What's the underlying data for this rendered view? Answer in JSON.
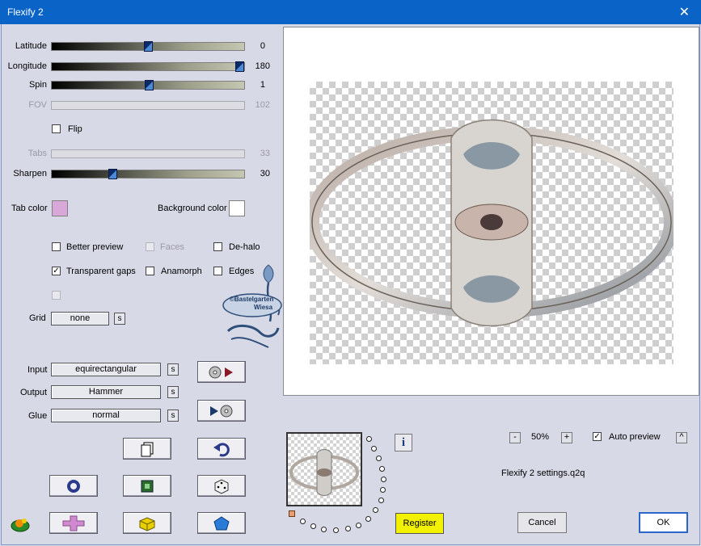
{
  "window": {
    "title": "Flexify 2",
    "close_glyph": "✕"
  },
  "sliders": [
    {
      "label": "Latitude",
      "value": "0",
      "fraction": 0.5,
      "enabled": true
    },
    {
      "label": "Longitude",
      "value": "180",
      "fraction": 1.0,
      "enabled": true
    },
    {
      "label": "Spin",
      "value": "1",
      "fraction": 0.505,
      "enabled": true
    },
    {
      "label": "FOV",
      "value": "102",
      "enabled": false
    },
    {
      "label": "Tabs",
      "value": "33",
      "enabled": false
    },
    {
      "label": "Sharpen",
      "value": "30",
      "fraction": 0.31,
      "enabled": true
    }
  ],
  "flip": {
    "label": "Flip",
    "checked": false
  },
  "tab_color": {
    "label": "Tab color",
    "color": "#d8a8d8"
  },
  "background_color": {
    "label": "Background color",
    "color": "#ffffff"
  },
  "options": {
    "better_preview": {
      "label": "Better preview",
      "checked": false
    },
    "faces": {
      "label": "Faces",
      "checked": false
    },
    "de_halo": {
      "label": "De-halo",
      "checked": false
    },
    "transparent_gaps": {
      "label": "Transparent gaps",
      "checked": true,
      "mark": "✓"
    },
    "anamorph": {
      "label": "Anamorph",
      "checked": false
    },
    "edges": {
      "label": "Edges",
      "checked": false
    }
  },
  "grid": {
    "label": "Grid",
    "value": "none",
    "s": "s"
  },
  "input": {
    "label": "Input",
    "value": "equirectangular",
    "s": "s"
  },
  "output": {
    "label": "Output",
    "value": "Hammer",
    "s": "s"
  },
  "glue": {
    "label": "Glue",
    "value": "normal",
    "s": "s"
  },
  "watermark": {
    "line1": "©Bastelgarten",
    "line2": "Wiesa"
  },
  "zoom": {
    "minus": "-",
    "value": "50%",
    "plus": "+"
  },
  "auto_preview": {
    "label": "Auto preview",
    "checked": true,
    "mark": "✓",
    "caret": "^"
  },
  "settings_file": "Flexify 2 settings.q2q",
  "info_glyph": "i",
  "buttons": {
    "register": "Register",
    "cancel": "Cancel",
    "ok": "OK"
  }
}
